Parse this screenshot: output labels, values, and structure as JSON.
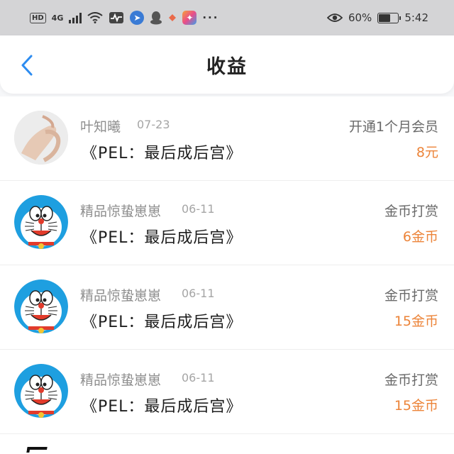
{
  "status_bar": {
    "hd": "HD",
    "network": "4G",
    "battery_percent": "60%",
    "time": "5:42",
    "battery_level": 0.6,
    "icons": [
      "hd-badge-icon",
      "signal-icon",
      "wifi-icon",
      "activity-icon",
      "blue-app-icon",
      "qq-icon",
      "diamond-icon",
      "colorful-app-icon",
      "more-dots-icon",
      "eye-icon",
      "battery-icon"
    ]
  },
  "header": {
    "title": "收益",
    "back_icon": "chevron-left-icon",
    "accent": "#2d8cf0"
  },
  "colors": {
    "amount": "#ec8439",
    "status_bar_bg": "#d4d4d6"
  },
  "records": [
    {
      "name": "叶知曦",
      "date": "07-23",
      "title": "《PEL：最后成后宫》",
      "type": "开通1个月会员",
      "amount": "8元",
      "avatar": "hand-photo"
    },
    {
      "name": "精品惊蛰崽崽",
      "date": "06-11",
      "title": "《PEL：最后成后宫》",
      "type": "金币打赏",
      "amount": "6金币",
      "avatar": "doraemon"
    },
    {
      "name": "精品惊蛰崽崽",
      "date": "06-11",
      "title": "《PEL：最后成后宫》",
      "type": "金币打赏",
      "amount": "15金币",
      "avatar": "doraemon"
    },
    {
      "name": "精品惊蛰崽崽",
      "date": "06-11",
      "title": "《PEL：最后成后宫》",
      "type": "金币打赏",
      "amount": "15金币",
      "avatar": "doraemon"
    }
  ]
}
